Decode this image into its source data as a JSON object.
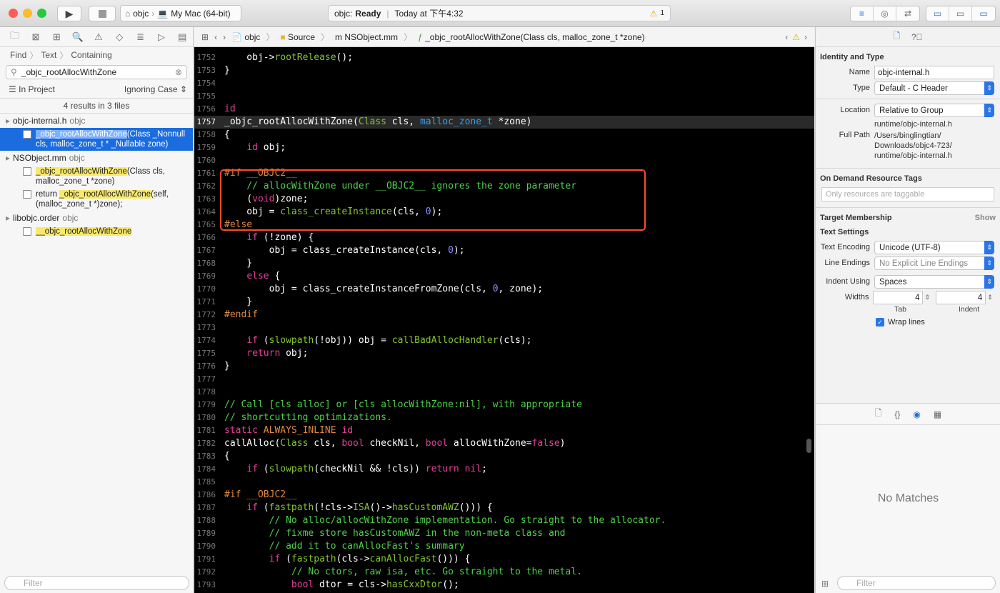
{
  "toolbar": {
    "scheme": "objc",
    "destination": "My Mac (64-bit)",
    "status_project": "objc:",
    "status_text": "Ready",
    "status_time": "Today at 下午4:32",
    "warning_count": "1"
  },
  "navigator": {
    "breadcrumb": [
      "Find",
      "Text",
      "Containing"
    ],
    "search_value": "_objc_rootAllocWithZone",
    "scope": "In Project",
    "case": "Ignoring Case",
    "result_count": "4 results in 3 files",
    "groups": [
      {
        "file": "objc-internal.h",
        "target": "objc",
        "results": [
          {
            "pre": "",
            "match": "_objc_rootAllocWithZone",
            "post": "(Class _Nonnull cls, malloc_zone_t * _Nullable zone)"
          }
        ]
      },
      {
        "file": "NSObject.mm",
        "target": "objc",
        "results": [
          {
            "pre": "",
            "match": "_objc_rootAllocWithZone",
            "post": "(Class cls, malloc_zone_t *zone)"
          },
          {
            "pre": "return ",
            "match": "_objc_rootAllocWithZone",
            "post": "(self, (malloc_zone_t *)zone);"
          }
        ]
      },
      {
        "file": "libobjc.order",
        "target": "objc",
        "results": [
          {
            "pre": "",
            "match": "__objc_rootAllocWithZone",
            "post": ""
          }
        ]
      }
    ],
    "filter_placeholder": "Filter"
  },
  "jumpbar": {
    "project": "objc",
    "folder": "Source",
    "file": "NSObject.mm",
    "symbol": "_objc_rootAllocWithZone(Class cls, malloc_zone_t *zone)"
  },
  "editor": {
    "lines": [
      {
        "n": "1752",
        "t": [
          [
            "    obj->",
            ""
          ],
          [
            "rootRelease",
            "fn"
          ],
          [
            "();",
            ""
          ]
        ]
      },
      {
        "n": "1753",
        "t": [
          [
            "}",
            ""
          ]
        ]
      },
      {
        "n": "1754",
        "t": []
      },
      {
        "n": "1755",
        "t": []
      },
      {
        "n": "1756",
        "t": [
          [
            "id",
            "kw"
          ]
        ]
      },
      {
        "n": "1757",
        "cur": true,
        "t": [
          [
            "_objc_rootAllocWithZone",
            ""
          ],
          [
            "(",
            ""
          ],
          [
            "Class",
            "fn"
          ],
          [
            " cls, ",
            ""
          ],
          [
            "malloc_zone_t",
            "ty"
          ],
          [
            " *zone)",
            ""
          ]
        ]
      },
      {
        "n": "1758",
        "t": [
          [
            "{",
            ""
          ]
        ]
      },
      {
        "n": "1759",
        "t": [
          [
            "    ",
            ""
          ],
          [
            "id",
            "kw"
          ],
          [
            " obj;",
            ""
          ]
        ]
      },
      {
        "n": "1760",
        "t": []
      },
      {
        "n": "1761",
        "t": [
          [
            "#if __OBJC2__",
            "pp"
          ]
        ]
      },
      {
        "n": "1762",
        "t": [
          [
            "    // allocWithZone under __OBJC2__ ignores the zone parameter",
            "cm"
          ]
        ]
      },
      {
        "n": "1763",
        "t": [
          [
            "    (",
            ""
          ],
          [
            "void",
            "kw"
          ],
          [
            ")zone;",
            ""
          ]
        ]
      },
      {
        "n": "1764",
        "t": [
          [
            "    obj = ",
            ""
          ],
          [
            "class_createInstance",
            "fn"
          ],
          [
            "(cls, ",
            ""
          ],
          [
            "0",
            "nm"
          ],
          [
            ");",
            ""
          ]
        ]
      },
      {
        "n": "1765",
        "t": [
          [
            "#else",
            "pp"
          ]
        ]
      },
      {
        "n": "1766",
        "t": [
          [
            "    ",
            ""
          ],
          [
            "if",
            "kw"
          ],
          [
            " (!zone) {",
            ""
          ]
        ]
      },
      {
        "n": "1767",
        "t": [
          [
            "        obj = class_createInstance(cls, ",
            ""
          ],
          [
            "0",
            "nm"
          ],
          [
            ");",
            ""
          ]
        ]
      },
      {
        "n": "1768",
        "t": [
          [
            "    }",
            ""
          ]
        ]
      },
      {
        "n": "1769",
        "t": [
          [
            "    ",
            ""
          ],
          [
            "else",
            "kw"
          ],
          [
            " {",
            ""
          ]
        ]
      },
      {
        "n": "1770",
        "t": [
          [
            "        obj = class_createInstanceFromZone(cls, ",
            ""
          ],
          [
            "0",
            "nm"
          ],
          [
            ", zone);",
            ""
          ]
        ]
      },
      {
        "n": "1771",
        "t": [
          [
            "    }",
            ""
          ]
        ]
      },
      {
        "n": "1772",
        "t": [
          [
            "#endif",
            "pp"
          ]
        ]
      },
      {
        "n": "1773",
        "t": []
      },
      {
        "n": "1774",
        "t": [
          [
            "    ",
            ""
          ],
          [
            "if",
            "kw"
          ],
          [
            " (",
            ""
          ],
          [
            "slowpath",
            "fn"
          ],
          [
            "(!obj)) obj = ",
            ""
          ],
          [
            "callBadAllocHandler",
            "fn"
          ],
          [
            "(cls);",
            ""
          ]
        ]
      },
      {
        "n": "1775",
        "t": [
          [
            "    ",
            ""
          ],
          [
            "return",
            "kw"
          ],
          [
            " obj;",
            ""
          ]
        ]
      },
      {
        "n": "1776",
        "t": [
          [
            "}",
            ""
          ]
        ]
      },
      {
        "n": "1777",
        "t": []
      },
      {
        "n": "1778",
        "t": []
      },
      {
        "n": "1779",
        "t": [
          [
            "// Call [cls alloc] or [cls allocWithZone:nil], with appropriate",
            "cm"
          ]
        ]
      },
      {
        "n": "1780",
        "t": [
          [
            "// shortcutting optimizations.",
            "cm"
          ]
        ]
      },
      {
        "n": "1781",
        "t": [
          [
            "static",
            "kw"
          ],
          [
            " ",
            ""
          ],
          [
            "ALWAYS_INLINE",
            "pp"
          ],
          [
            " ",
            ""
          ],
          [
            "id",
            "kw"
          ]
        ]
      },
      {
        "n": "1782",
        "t": [
          [
            "callAlloc(",
            ""
          ],
          [
            "Class",
            "fn"
          ],
          [
            " cls, ",
            ""
          ],
          [
            "bool",
            "kw"
          ],
          [
            " checkNil, ",
            ""
          ],
          [
            "bool",
            "kw"
          ],
          [
            " allocWithZone=",
            ""
          ],
          [
            "false",
            "kw"
          ],
          [
            ")",
            ""
          ]
        ]
      },
      {
        "n": "1783",
        "t": [
          [
            "{",
            ""
          ]
        ]
      },
      {
        "n": "1784",
        "t": [
          [
            "    ",
            ""
          ],
          [
            "if",
            "kw"
          ],
          [
            " (",
            ""
          ],
          [
            "slowpath",
            "fn"
          ],
          [
            "(checkNil && !cls)) ",
            ""
          ],
          [
            "return",
            "kw"
          ],
          [
            " ",
            ""
          ],
          [
            "nil",
            "kw"
          ],
          [
            ";",
            ""
          ]
        ]
      },
      {
        "n": "1785",
        "t": []
      },
      {
        "n": "1786",
        "t": [
          [
            "#if __OBJC2__",
            "pp"
          ]
        ]
      },
      {
        "n": "1787",
        "t": [
          [
            "    ",
            ""
          ],
          [
            "if",
            "kw"
          ],
          [
            " (",
            ""
          ],
          [
            "fastpath",
            "fn"
          ],
          [
            "(!cls->",
            ""
          ],
          [
            "ISA",
            "fn"
          ],
          [
            "()->",
            ""
          ],
          [
            "hasCustomAWZ",
            "fn"
          ],
          [
            "())) {",
            ""
          ]
        ]
      },
      {
        "n": "1788",
        "t": [
          [
            "        // No alloc/allocWithZone implementation. Go straight to the allocator.",
            "cm"
          ]
        ]
      },
      {
        "n": "1789",
        "t": [
          [
            "        // fixme store hasCustomAWZ in the non-meta class and",
            "cm"
          ]
        ]
      },
      {
        "n": "1790",
        "t": [
          [
            "        // add it to canAllocFast's summary",
            "cm"
          ]
        ]
      },
      {
        "n": "1791",
        "t": [
          [
            "        ",
            ""
          ],
          [
            "if",
            "kw"
          ],
          [
            " (",
            ""
          ],
          [
            "fastpath",
            "fn"
          ],
          [
            "(cls->",
            ""
          ],
          [
            "canAllocFast",
            "fn"
          ],
          [
            "())) {",
            ""
          ]
        ]
      },
      {
        "n": "1792",
        "t": [
          [
            "            // No ctors, raw isa, etc. Go straight to the metal.",
            "cm"
          ]
        ]
      },
      {
        "n": "1793",
        "t": [
          [
            "            ",
            ""
          ],
          [
            "bool",
            "kw"
          ],
          [
            " dtor = cls->",
            ""
          ],
          [
            "hasCxxDtor",
            "fn"
          ],
          [
            "();",
            ""
          ]
        ]
      }
    ]
  },
  "inspector": {
    "identity_title": "Identity and Type",
    "name_label": "Name",
    "name": "objc-internal.h",
    "type_label": "Type",
    "type": "Default - C Header",
    "location_label": "Location",
    "location": "Relative to Group",
    "location_path": "runtime/objc-internal.h",
    "fullpath_label": "Full Path",
    "fullpath": "/Users/binglingtian/ Downloads/objc4-723/ runtime/objc-internal.h",
    "tags_title": "On Demand Resource Tags",
    "tags_placeholder": "Only resources are taggable",
    "membership_title": "Target Membership",
    "membership_show": "Show",
    "text_title": "Text Settings",
    "encoding_label": "Text Encoding",
    "encoding": "Unicode (UTF-8)",
    "endings_label": "Line Endings",
    "endings": "No Explicit Line Endings",
    "indent_label": "Indent Using",
    "indent": "Spaces",
    "widths_label": "Widths",
    "tab_width": "4",
    "indent_width": "4",
    "tab_caption": "Tab",
    "indent_caption": "Indent",
    "wrap_label": "Wrap lines",
    "no_matches": "No Matches",
    "filter_placeholder": "Filter"
  }
}
